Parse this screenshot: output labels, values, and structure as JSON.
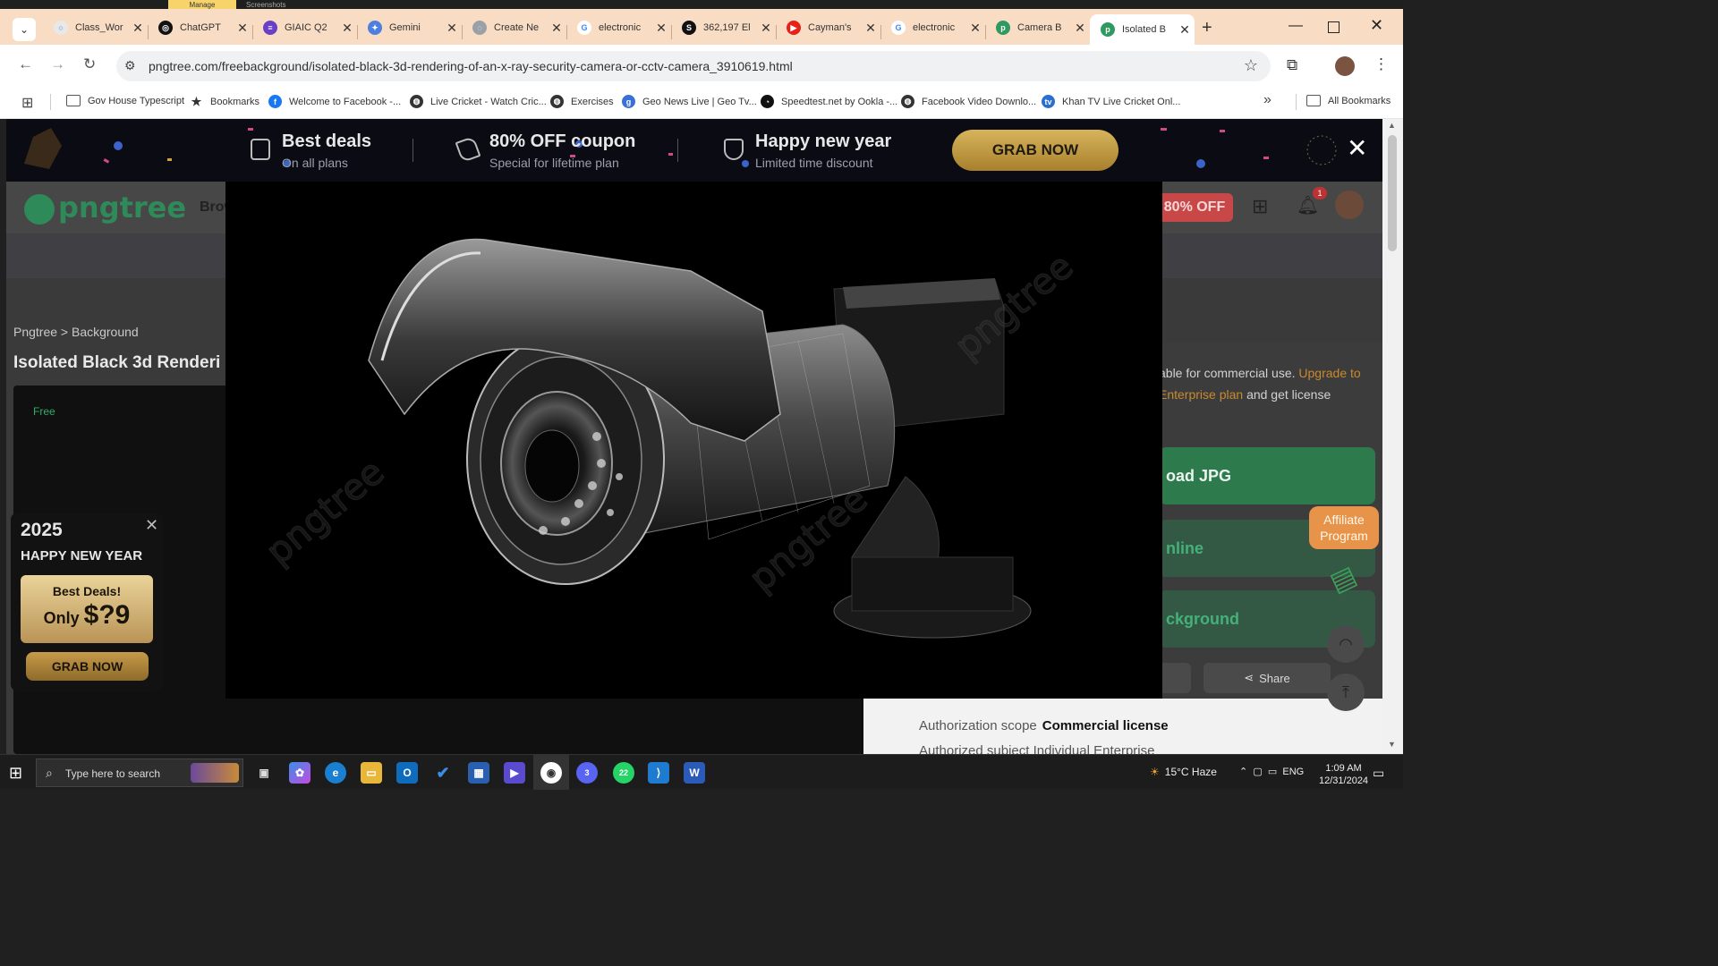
{
  "explorer": {
    "manage": "Manage",
    "screenshots": "Screenshots"
  },
  "tabs": [
    {
      "label": "Class_Wor",
      "color": "#e8e8e8",
      "glyph": "○"
    },
    {
      "label": "ChatGPT",
      "color": "#111111",
      "glyph": "◎"
    },
    {
      "label": "GIAIC Q2",
      "color": "#6a3fc8",
      "glyph": "≡"
    },
    {
      "label": "Gemini",
      "color": "#4c7fe0",
      "glyph": "✦"
    },
    {
      "label": "Create Ne",
      "color": "#9aa0a6",
      "glyph": "◌"
    },
    {
      "label": "electronic",
      "color": "#ffffff",
      "glyph": "G"
    },
    {
      "label": "362,197 El",
      "color": "#111111",
      "glyph": "S"
    },
    {
      "label": "Cayman's",
      "color": "#e62117",
      "glyph": "▶"
    },
    {
      "label": "electronic",
      "color": "#ffffff",
      "glyph": "G"
    },
    {
      "label": "Camera B",
      "color": "#2f9a60",
      "glyph": "p"
    },
    {
      "label": "Isolated B",
      "color": "#2f9a60",
      "glyph": "p"
    }
  ],
  "toolbar": {
    "url": "pngtree.com/freebackground/isolated-black-3d-rendering-of-an-x-ray-security-camera-or-cctv-camera_3910619.html"
  },
  "bookmarks": [
    {
      "label": "Gov House Typescript",
      "icon": "folder-icon"
    },
    {
      "label": "Bookmarks",
      "icon": "star-icon"
    },
    {
      "label": "Welcome to Facebook -...",
      "icon": "facebook-icon"
    },
    {
      "label": "Live Cricket - Watch Cric...",
      "icon": "globe-icon"
    },
    {
      "label": "Exercises",
      "icon": "globe-icon"
    },
    {
      "label": "Geo News Live | Geo Tv...",
      "icon": "geo-icon"
    },
    {
      "label": "Speedtest.net by Ookla -...",
      "icon": "speedtest-icon"
    },
    {
      "label": "Facebook Video Downlo...",
      "icon": "globe-icon"
    },
    {
      "label": "Khan TV Live Cricket Onl...",
      "icon": "tv-icon"
    }
  ],
  "bookmarks_more": "»",
  "all_bookmarks": "All Bookmarks",
  "promo": {
    "item1_title": "Best deals",
    "item1_sub": "On all plans",
    "item2_title": "80% OFF coupon",
    "item2_sub": "Special for lifetime plan",
    "item3_title": "Happy new year",
    "item3_sub": "Limited time discount",
    "grab": "GRAB NOW"
  },
  "site": {
    "logo": "pngtree",
    "browse": "Brow",
    "off_badge": "80% OFF",
    "bell_count": "1",
    "breadcrumb": "Pngtree > Background",
    "title": "Isolated Black 3d Renderi",
    "free": "Free",
    "license_text_1": "able for commercial use.",
    "license_upgrade": "Upgrade to Enterprise plan",
    "license_text_2": "and get license",
    "download_jpg": "oad JPG",
    "edit_online": "nline",
    "remove_bg": "ckground",
    "share": "Share",
    "auth_scope_label": "Authorization scope",
    "auth_scope_value": "Commercial license",
    "auth_subject": "Authorized subject  Individual  Enterprise",
    "affiliate": "Affiliate Program"
  },
  "newyear": {
    "year": "2025",
    "title": "HAPPY NEW YEAR",
    "deal_line1": "Best Deals!",
    "deal_only": "Only",
    "deal_price": "$?9",
    "grab": "GRAB NOW"
  },
  "taskbar": {
    "search_placeholder": "Type here to search",
    "weather": "15°C  Haze",
    "lang": "ENG",
    "time": "1:09 AM",
    "date": "12/31/2024",
    "chrome_badge": "3",
    "whatsapp_badge": "22"
  },
  "colors": {
    "tabbar": "#f9dcc4",
    "accent_green": "#2f8a5a",
    "gold": "#c9a14a"
  }
}
